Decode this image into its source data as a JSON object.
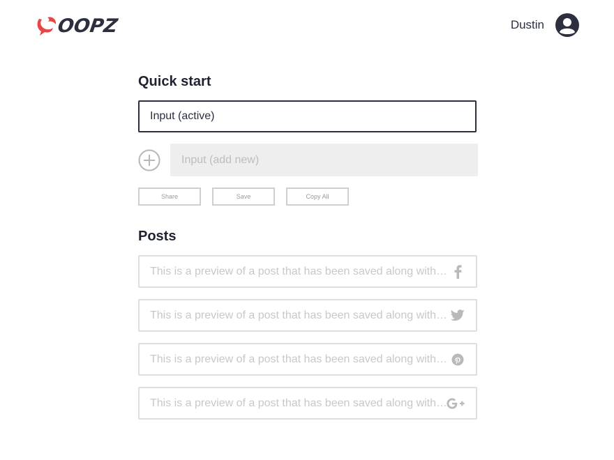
{
  "brand": {
    "name": "OOPZ",
    "accent_color": "#e84545"
  },
  "header": {
    "user_name": "Dustin",
    "avatar_icon": "user-avatar-icon"
  },
  "quick_start": {
    "title": "Quick start",
    "active_input_value": "Input (active)",
    "add_new_placeholder": "Input (add new)",
    "buttons": {
      "share": "Share",
      "save": "Save",
      "copy_all": "Copy All"
    }
  },
  "posts": {
    "title": "Posts",
    "items": [
      {
        "text": "This is a preview of a post that has been saved along with…",
        "network_icon": "facebook-icon"
      },
      {
        "text": "This is a preview of a post that has been saved along with…",
        "network_icon": "twitter-icon"
      },
      {
        "text": "This is a preview of a post that has been saved along with…",
        "network_icon": "pinterest-icon"
      },
      {
        "text": "This is a preview of a post that has been saved along with…",
        "network_icon": "google-plus-icon"
      }
    ]
  }
}
